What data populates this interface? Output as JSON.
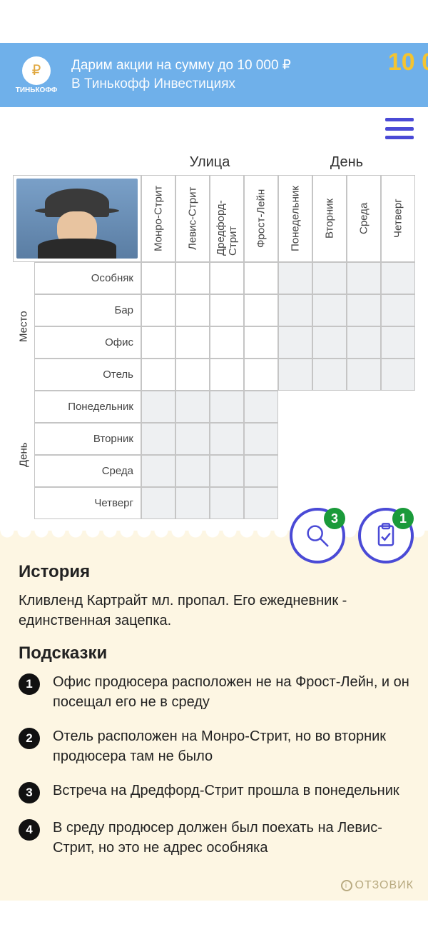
{
  "ad": {
    "brand": "ТИНЬКОФФ",
    "line1": "Дарим акции на сумму до 10 000 ₽",
    "line2": "В Тинькофф Инвестициях",
    "deco": "10 0"
  },
  "grid": {
    "top_groups": [
      "Улица",
      "День"
    ],
    "side_groups": [
      "Место",
      "День"
    ],
    "cols_street": [
      "Монро-Стрит",
      "Левис-Стрит",
      "Дредфорд-Стрит",
      "Фрост-Лейн"
    ],
    "cols_day": [
      "Понедельник",
      "Вторник",
      "Среда",
      "Четверг"
    ],
    "rows_place": [
      "Особняк",
      "Бар",
      "Офис",
      "Отель"
    ],
    "rows_day": [
      "Понедельник",
      "Вторник",
      "Среда",
      "Четверг"
    ]
  },
  "fab": {
    "hints_badge": "3",
    "check_badge": "1"
  },
  "story": {
    "title": "История",
    "text": "Кливленд Картрайт мл. пропал. Его ежедневник - единственная зацепка."
  },
  "clues": {
    "title": "Подсказки",
    "items": [
      "Офис продюсера расположен не на Фрост-Лейн, и он посещал его не в среду",
      "Отель расположен на Монро-Стрит, но во вторник продюсера там не было",
      "Встреча на Дредфорд-Стрит прошла в понедельник",
      "В среду продюсер должен был поехать на Левис-Стрит, но это не адрес особняка"
    ]
  },
  "watermark": "ОТЗОВИК"
}
